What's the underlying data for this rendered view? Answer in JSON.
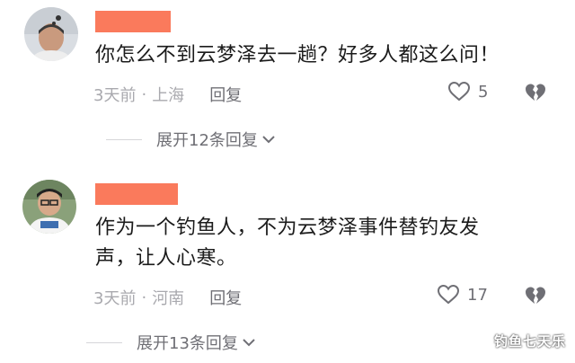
{
  "comments": [
    {
      "text": "你怎么不到云梦泽去一趟？好多人都这么问！",
      "time": "3天前",
      "separator": "·",
      "location": "上海",
      "reply_label": "回复",
      "likes": "5",
      "expand_label": "展开12条回复"
    },
    {
      "text_line1": "作为一个钓鱼人，不为云梦泽事件替钓友发",
      "text_line2": "声，让人心寒。",
      "time": "3天前",
      "separator": "·",
      "location": "河南",
      "reply_label": "回复",
      "likes": "17",
      "expand_label": "展开13条回复"
    }
  ],
  "watermark": "钓鱼七天乐",
  "colors": {
    "name_redaction": "#fa7a5c",
    "meta": "#a9a9ae",
    "action": "#6f6f75"
  },
  "icons": [
    "heart-outline-icon",
    "broken-heart-icon",
    "chevron-down-icon"
  ]
}
